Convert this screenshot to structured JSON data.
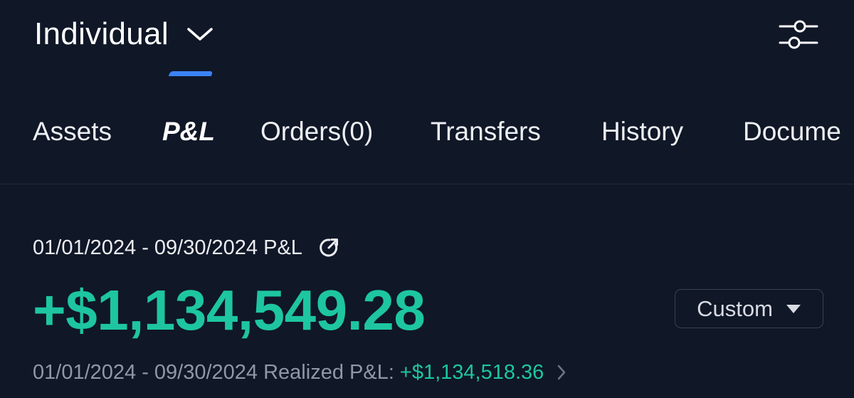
{
  "header": {
    "account_title": "Individual",
    "icons": {
      "dropdown": "chevron-down-icon",
      "settings": "sliders-icon"
    }
  },
  "tabs": [
    {
      "label": "Assets",
      "active": false
    },
    {
      "label": "P&L",
      "active": true
    },
    {
      "label": "Orders(0)",
      "active": false
    },
    {
      "label": "Transfers",
      "active": false
    },
    {
      "label": "History",
      "active": false
    },
    {
      "label": "Docume",
      "active": false
    }
  ],
  "pnl": {
    "range_label": "01/01/2024 - 09/30/2024 P&L",
    "total_value": "+$1,134,549.28",
    "range_selector": {
      "value": "Custom"
    },
    "realized_label": "01/01/2024 - 09/30/2024 Realized P&L:",
    "realized_value": "+$1,134,518.36",
    "icons": {
      "share": "share-icon",
      "caret": "caret-down-icon",
      "arrow": "chevron-right-icon"
    }
  },
  "colors": {
    "background": "#101727",
    "accent_green": "#1dc6a0",
    "tab_indicator": "#3b82f6",
    "muted_text": "#9098a8",
    "divider": "#242c3d"
  }
}
